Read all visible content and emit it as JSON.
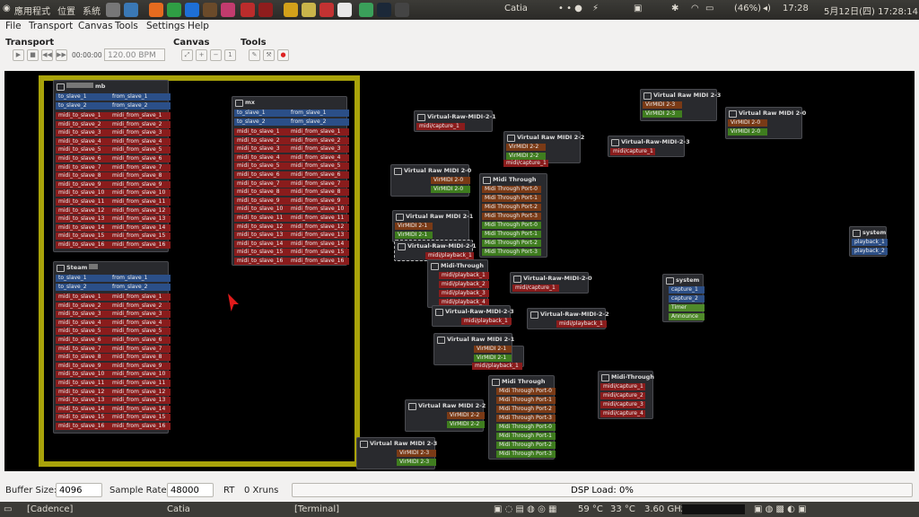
{
  "topbar": {
    "apps": "應用程式",
    "places": "位置",
    "system": "系統",
    "app_name": "Catia",
    "battery": "(46%)",
    "time_short": "17:28",
    "datetime": "5月12日(四) 17:28:14"
  },
  "menu": [
    "File",
    "Transport",
    "Canvas",
    "Tools",
    "Settings",
    "Help"
  ],
  "toolbar": {
    "transport_label": "Transport",
    "canvas_label": "Canvas",
    "tools_label": "Tools",
    "time": "00:00:00",
    "bpm": "120.00 BPM"
  },
  "bottom": {
    "buffer_label": "Buffer Size:",
    "buffer_value": "4096",
    "sample_label": "Sample Rate:",
    "sample_value": "48000",
    "rt": "RT",
    "xruns": "0 Xruns",
    "dsp": "DSP Load: 0%"
  },
  "taskbar": {
    "cadence": "[Cadence]",
    "catia": "Catia",
    "terminal": "[Terminal]",
    "temp1": "59 °C",
    "temp2": "33 °C",
    "freq": "3.60 GHz"
  },
  "canvas": {
    "box_mb": "mb",
    "box_mx": "mx",
    "box_steam": "Steam",
    "vr121": "Virtual-Raw-MIDI-2-1",
    "vr123": "Virtual-Raw-MIDI-2-3",
    "vr120": "Virtual-Raw-MIDI-2-0",
    "vr122": "Virtual-Raw-MIDI-2-2",
    "vm23": "Virtual Raw MIDI 2-3",
    "vm22": "Virtual Raw MIDI 2-2",
    "vm20": "Virtual Raw MIDI 2-0",
    "vm21": "Virtual Raw MIDI 2-1",
    "midi_through": "Midi Through",
    "midi_through2": "Midi-Through",
    "system": "system",
    "mc1": "midi/capture_1",
    "mc2": "midi/capture_2",
    "mc3": "midi/capture_3",
    "mc4": "midi/capture_4",
    "mp1": "midi/playback_1",
    "mp2": "midi/playback_2",
    "mp3": "midi/playback_3",
    "mp4": "midi/playback_4",
    "v20": "VirMIDI 2-0",
    "v21": "VirMIDI 2-1",
    "v22": "VirMIDI 2-2",
    "v23": "VirMIDI 2-3",
    "mtp0": "Midi Through Port-0",
    "mtp1": "Midi Through Port-1",
    "mtp2": "Midi Through Port-2",
    "mtp3": "Midi Through Port-3",
    "cap1": "capture_1",
    "cap2": "capture_2",
    "timer": "Timer",
    "announce": "Announce",
    "pb1": "playback_1",
    "pb2": "playback_2",
    "to_slave_1": "to_slave_1",
    "to_slave_2": "to_slave_2",
    "from_slave_1": "from_slave_1",
    "from_slave_2": "from_slave_2",
    "mts": [
      "midi_to_slave_1",
      "midi_to_slave_2",
      "midi_to_slave_3",
      "midi_to_slave_4",
      "midi_to_slave_5",
      "midi_to_slave_6",
      "midi_to_slave_7",
      "midi_to_slave_8",
      "midi_to_slave_9",
      "midi_to_slave_10",
      "midi_to_slave_11",
      "midi_to_slave_12",
      "midi_to_slave_13",
      "midi_to_slave_14",
      "midi_to_slave_15",
      "midi_to_slave_16"
    ],
    "mfs": [
      "midi_from_slave_1",
      "midi_from_slave_2",
      "midi_from_slave_3",
      "midi_from_slave_4",
      "midi_from_slave_5",
      "midi_from_slave_6",
      "midi_from_slave_7",
      "midi_from_slave_8",
      "midi_from_slave_9",
      "midi_from_slave_10",
      "midi_from_slave_11",
      "midi_from_slave_12",
      "midi_from_slave_13",
      "midi_from_slave_14",
      "midi_from_slave_15",
      "midi_from_slave_16"
    ]
  },
  "colors": {
    "selection_frame": "#a9a30a",
    "midi_port": "#8a1c1c",
    "audio_port": "#2b4f88",
    "virmidi_in": "#7a3a16",
    "virmidi_out": "#3f7d1f"
  }
}
